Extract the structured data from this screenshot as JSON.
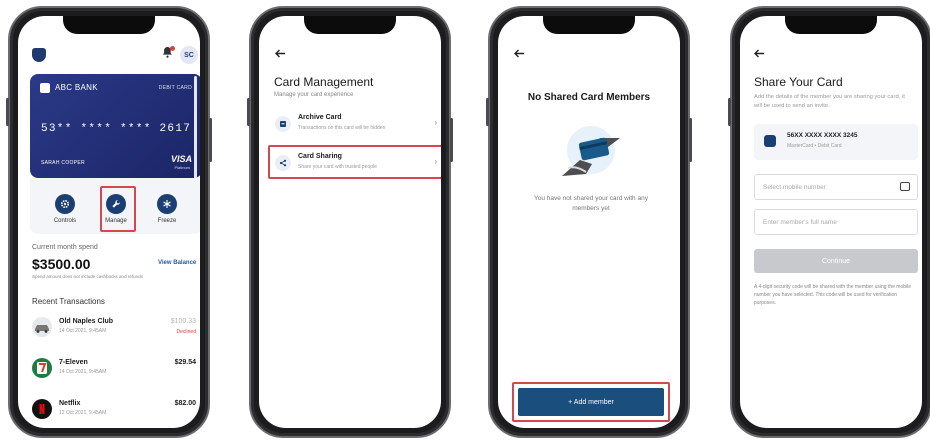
{
  "colors": {
    "accent": "#1b3f73",
    "card": "#2b3987",
    "highlight": "#d24a50",
    "declined": "#d6453b"
  },
  "screen1": {
    "avatar": "SC",
    "card": {
      "bank": "ABC BANK",
      "type": "DEBIT CARD",
      "number": "53** **** **** 2617",
      "holder": "SARAH COOPER",
      "network": "VISA",
      "tier": "Platinum"
    },
    "actions": [
      {
        "label": "Controls",
        "icon": "gear-icon"
      },
      {
        "label": "Manage",
        "icon": "wrench-icon"
      },
      {
        "label": "Freeze",
        "icon": "snowflake-icon"
      }
    ],
    "spend_label": "Current month spend",
    "spend_amount": "$3500.00",
    "view_balance": "View Balance",
    "spend_note": "Spend amount does not include cashbacks and refunds",
    "recent_heading": "Recent Transactions",
    "transactions": [
      {
        "name": "Old Naples Club",
        "date": "14 Oct 2021, 9:45AM",
        "amount": "$100.33",
        "status": "Declined",
        "icon": "car-icon"
      },
      {
        "name": "7-Eleven",
        "date": "14 Oct 2021, 9:45AM",
        "amount": "$29.54",
        "status": "",
        "icon": "seven-eleven-logo"
      },
      {
        "name": "Netflix",
        "date": "12 Oct 2021, 9:45AM",
        "amount": "$82.00",
        "status": "",
        "icon": "netflix-logo"
      }
    ]
  },
  "screen2": {
    "title": "Card Management",
    "subtitle": "Manage your card experience",
    "options": [
      {
        "title": "Archive Card",
        "desc": "Transactions on this card will be hidden",
        "icon": "archive-icon"
      },
      {
        "title": "Card Sharing",
        "desc": "Share your card with trusted people",
        "icon": "share-icon"
      }
    ]
  },
  "screen3": {
    "title": "No Shared Card Members",
    "message": "You have not shared your card with any members yet",
    "add_button": "+ Add member"
  },
  "screen4": {
    "title": "Share Your Card",
    "subtitle": "Add the details of the member you are sharing your card, it will be used to send an invite.",
    "card_number": "56XX XXXX XXXX 3245",
    "card_meta": "MasterCard • Debit Card",
    "mobile_placeholder": "Select mobile number",
    "name_placeholder": "Enter member's full name",
    "continue": "Continue",
    "note": "A 4-digit security code will be shared with the member using the mobile number you have selected. This code will be used for verification purposes."
  }
}
